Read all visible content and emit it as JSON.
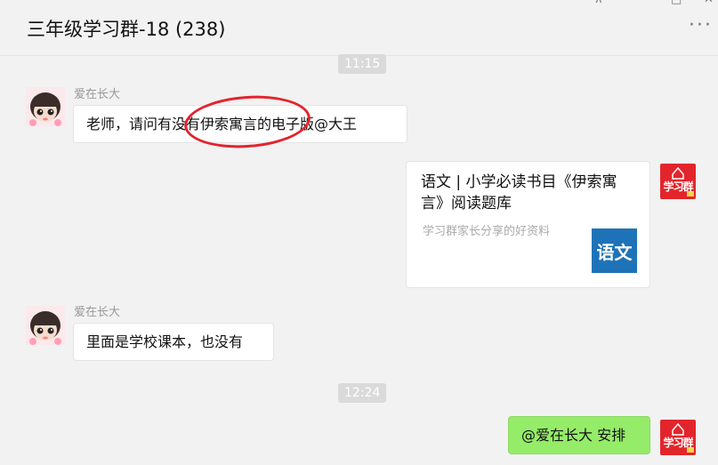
{
  "window": {
    "title": "三年级学习群-18 (238)",
    "controls": {
      "pin": "⊼",
      "minimize": "–",
      "maximize": "□",
      "close": "✕"
    },
    "more_icon": "more-dots-icon"
  },
  "messages": [
    {
      "type": "time",
      "text": "11:15"
    },
    {
      "type": "text",
      "side": "left",
      "sender": "爱在长大",
      "text": "老师，请问有没有伊索寓言的电子版@大王",
      "annotation": "red-circle-highlight"
    },
    {
      "type": "card",
      "side": "right",
      "title": "语文 | 小学必读书目《伊索寓言》阅读题库",
      "desc": "学习群家长分享的好资料",
      "thumb_text": "语文",
      "avatar_text": "学习群"
    },
    {
      "type": "text",
      "side": "left",
      "sender": "爱在长大",
      "text": "里面是学校课本，也没有"
    },
    {
      "type": "time",
      "text": "12:24"
    },
    {
      "type": "text",
      "side": "right",
      "text": "@爱在长大 安排",
      "avatar_text": "学习群"
    }
  ],
  "colors": {
    "background": "#f2f2f2",
    "self_bubble": "#95ec69",
    "other_bubble": "#ffffff",
    "highlight_circle": "#e3232c",
    "brand_avatar": "#e2252b",
    "thumb": "#1e73b8"
  }
}
